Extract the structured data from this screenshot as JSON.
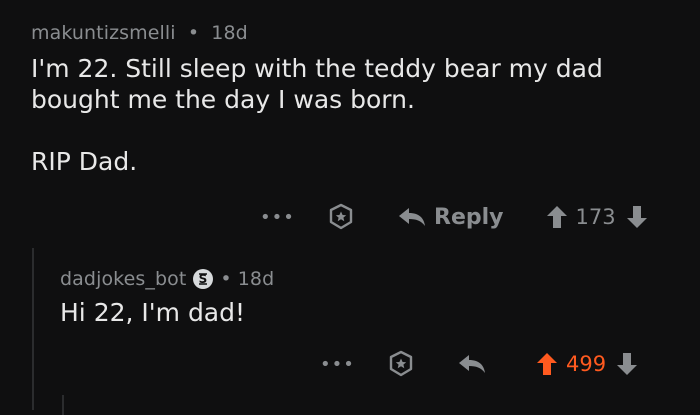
{
  "comment1": {
    "username": "makuntizsmelli",
    "separator": "•",
    "age": "18d",
    "text_line1": "I'm 22. Still sleep with the teddy bear my dad",
    "text_line2": "bought me the day I was born.",
    "text_line3": "RIP Dad.",
    "actions": {
      "more": "•••",
      "reply_label": "Reply",
      "score": "173"
    }
  },
  "comment2": {
    "username": "dadjokes_bot",
    "separator": "•",
    "age": "18d",
    "text": "Hi 22, I'm dad!",
    "actions": {
      "more": "•••",
      "score": "499",
      "upvoted": true,
      "upvote_color": "#ff5a1f"
    }
  },
  "icons": {
    "award": "award-star-icon",
    "reply": "reply-arrow-icon",
    "upvote": "upvote-arrow-icon",
    "downvote": "downvote-arrow-icon",
    "bot_badge": "bot-badge-icon"
  }
}
